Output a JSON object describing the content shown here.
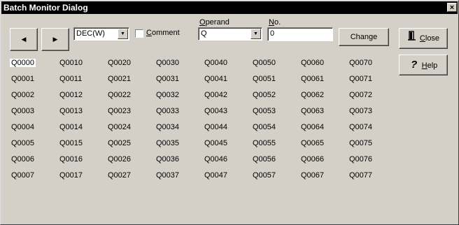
{
  "window": {
    "title": "Batch Monitor Dialog",
    "close_glyph": "×"
  },
  "toolbar": {
    "prev_glyph": "◀",
    "next_glyph": "▶",
    "format_value": "DEC(W)",
    "comment_label_accel": "C",
    "comment_label_rest": "omment",
    "comment_checked": false,
    "operand_label_accel": "O",
    "operand_label_rest": "perand",
    "operand_value": "Q",
    "no_label_accel": "N",
    "no_label_rest": "o.",
    "no_value": "0",
    "change_label": "Change",
    "dropdown_glyph": "▼"
  },
  "side": {
    "close_accel": "C",
    "close_rest": "lose",
    "close_icon": "door-icon",
    "help_accel": "H",
    "help_rest": "elp",
    "help_icon": "question-icon",
    "help_glyph": "?"
  },
  "grid": {
    "selected": "Q0000",
    "columns": [
      [
        "Q0000",
        "Q0001",
        "Q0002",
        "Q0003",
        "Q0004",
        "Q0005",
        "Q0006",
        "Q0007"
      ],
      [
        "Q0010",
        "Q0011",
        "Q0012",
        "Q0013",
        "Q0014",
        "Q0015",
        "Q0016",
        "Q0017"
      ],
      [
        "Q0020",
        "Q0021",
        "Q0022",
        "Q0023",
        "Q0024",
        "Q0025",
        "Q0026",
        "Q0027"
      ],
      [
        "Q0030",
        "Q0031",
        "Q0032",
        "Q0033",
        "Q0034",
        "Q0035",
        "Q0036",
        "Q0037"
      ],
      [
        "Q0040",
        "Q0041",
        "Q0042",
        "Q0043",
        "Q0044",
        "Q0045",
        "Q0046",
        "Q0047"
      ],
      [
        "Q0050",
        "Q0051",
        "Q0052",
        "Q0053",
        "Q0054",
        "Q0055",
        "Q0056",
        "Q0057"
      ],
      [
        "Q0060",
        "Q0061",
        "Q0062",
        "Q0063",
        "Q0064",
        "Q0065",
        "Q0066",
        "Q0067"
      ],
      [
        "Q0070",
        "Q0071",
        "Q0072",
        "Q0073",
        "Q0074",
        "Q0075",
        "Q0076",
        "Q0077"
      ]
    ]
  }
}
